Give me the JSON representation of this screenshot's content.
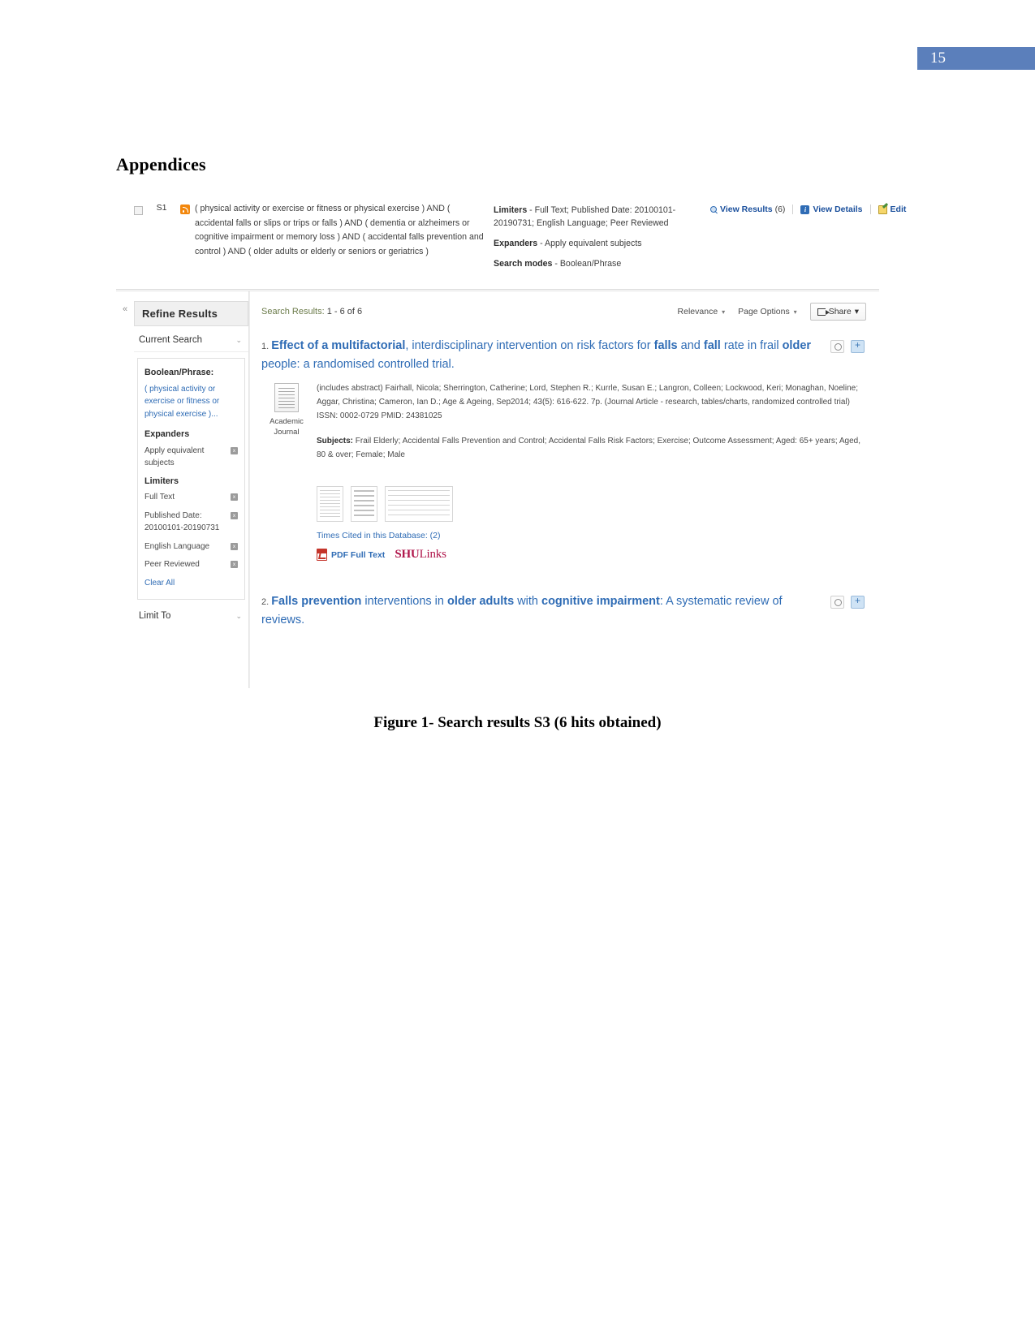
{
  "page": {
    "number": "15",
    "heading": "Appendices",
    "figure_caption": "Figure 1- Search results S3 (6 hits obtained)"
  },
  "search_history": {
    "row_id": "S1",
    "rss_icon": "rss-icon",
    "query": "( physical activity or exercise or fitness or physical exercise ) AND ( accidental falls or slips or trips or falls ) AND ( dementia or alzheimers or cognitive impairment or memory loss ) AND ( accidental falls prevention and control ) AND ( older adults or elderly or seniors or geriatrics )",
    "limiters_label": "Limiters",
    "limiters_value": "- Full Text; Published Date: 20100101-20190731; English Language; Peer Reviewed",
    "expanders_label": "Expanders",
    "expanders_value": "- Apply equivalent subjects",
    "search_modes_label": "Search modes",
    "search_modes_value": "- Boolean/Phrase",
    "actions": {
      "view_results": "View Results",
      "view_results_count": "(6)",
      "view_details": "View Details",
      "edit": "Edit"
    }
  },
  "sidebar": {
    "collapse_glyph": "«",
    "title": "Refine Results",
    "current_search": {
      "label": "Current Search",
      "chevron": "⌄"
    },
    "boolean_phrase_label": "Boolean/Phrase:",
    "boolean_phrase_value": "( physical activity or exercise or fitness or physical exercise )...",
    "expanders_label": "Expanders",
    "expander_items": [
      {
        "label": "Apply equivalent subjects",
        "remove": "x"
      }
    ],
    "limiters_label": "Limiters",
    "limiter_items": [
      {
        "label": "Full Text",
        "remove": "x"
      },
      {
        "label": "Published Date: 20100101-20190731",
        "remove": "x"
      },
      {
        "label": "English Language",
        "remove": "x"
      },
      {
        "label": "Peer Reviewed",
        "remove": "x"
      }
    ],
    "clear_all": "Clear All",
    "limit_to": {
      "label": "Limit To",
      "chevron": "⌄"
    }
  },
  "results_toolbar": {
    "count_label": "Search Results:",
    "count_value": "1 - 6 of 6",
    "relevance": "Relevance",
    "page_options": "Page Options",
    "share": "Share",
    "caret": "▾"
  },
  "records": [
    {
      "number": "1.",
      "title_parts": [
        {
          "t": "Effect of a multifactorial",
          "hl": true
        },
        {
          "t": ", interdisciplinary intervention on risk factors for ",
          "hl": false
        },
        {
          "t": "falls",
          "hl": true
        },
        {
          "t": " and ",
          "hl": false
        },
        {
          "t": "fall",
          "hl": true
        },
        {
          "t": " rate in frail ",
          "hl": false
        },
        {
          "t": "older",
          "hl": true
        },
        {
          "t": " people: a randomised controlled trial.",
          "hl": false
        }
      ],
      "source_type": "Academic Journal",
      "citation": "(includes abstract) Fairhall, Nicola; Sherrington, Catherine; Lord, Stephen R.; Kurrle, Susan E.; Langron, Colleen; Lockwood, Keri; Monaghan, Noeline; Aggar, Christina; Cameron, Ian D.; Age & Ageing, Sep2014; 43(5): 616-622. 7p. (Journal Article - research, tables/charts, randomized controlled trial) ISSN: 0002-0729 PMID: 24381025",
      "subjects_label": "Subjects:",
      "subjects_value": "Frail Elderly; Accidental Falls Prevention and Control; Accidental Falls Risk Factors; Exercise; Outcome Assessment; Aged: 65+ years; Aged, 80 & over; Female; Male",
      "times_cited": "Times Cited in this Database: (2)",
      "pdf_full_text": "PDF Full Text",
      "shu_links_bold": "SHU",
      "shu_links_rest": "Links",
      "icons": [
        "preview-icon",
        "add-to-folder-icon"
      ]
    },
    {
      "number": "2.",
      "title_parts": [
        {
          "t": "Falls prevention",
          "hl": true
        },
        {
          "t": " interventions in ",
          "hl": false
        },
        {
          "t": "older adults",
          "hl": true
        },
        {
          "t": " with ",
          "hl": false
        },
        {
          "t": "cognitive impairment",
          "hl": true
        },
        {
          "t": ": A systematic review of reviews.",
          "hl": false
        }
      ],
      "icons": [
        "preview-icon",
        "add-to-folder-icon"
      ]
    }
  ],
  "colors": {
    "page_number_bar": "#5b7fbb",
    "link_blue": "#2f6cb5",
    "shu_red": "#b0164b",
    "count_olive": "#6b7b4a"
  }
}
